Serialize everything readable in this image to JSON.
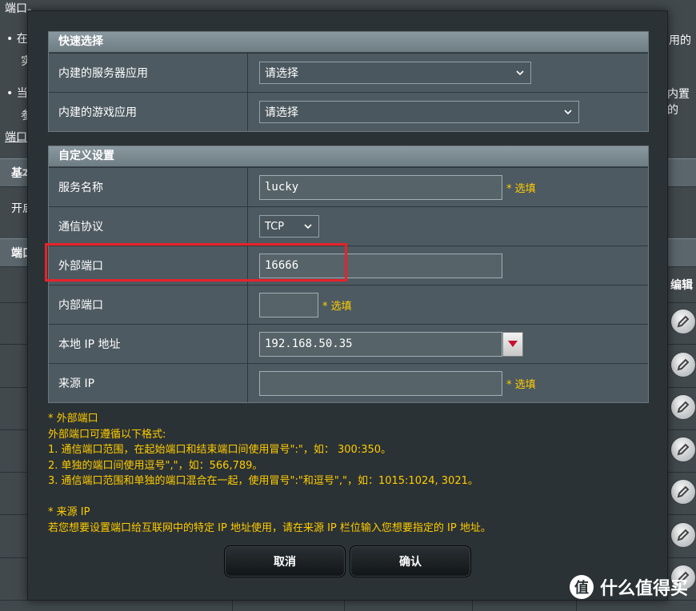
{
  "background": {
    "text_top": "端口。",
    "bullet_1_char": "在",
    "bullet_1_line2": "实",
    "bullet_1_right": "用的",
    "bullet_2_char": "当",
    "bullet_2_line2": "参",
    "bullet_2_right": "内置的",
    "section_link": "端口",
    "header_basic": "基本",
    "enable_label": "开启",
    "header_list": "端口",
    "column_edit": "编辑"
  },
  "quick_select": {
    "title": "快速选择",
    "rows": [
      {
        "label": "内建的服务器应用",
        "value": "请选择"
      },
      {
        "label": "内建的游戏应用",
        "value": "请选择"
      }
    ]
  },
  "custom": {
    "title": "自定义设置",
    "service_name": {
      "label": "服务名称",
      "value": "lucky",
      "hint": "* 选填"
    },
    "protocol": {
      "label": "通信协议",
      "value": "TCP"
    },
    "external_port": {
      "label": "外部端口",
      "value": "16666"
    },
    "internal_port": {
      "label": "内部端口",
      "value": "",
      "hint": "* 选填"
    },
    "local_ip": {
      "label": "本地 IP 地址",
      "value": "192.168.50.35"
    },
    "source_ip": {
      "label": "来源 IP",
      "value": "",
      "hint": "* 选填"
    }
  },
  "notes": {
    "ext_title": "* 外部端口",
    "ext_intro": "外部端口可遵循以下格式:",
    "ext_1": "1. 通信端口范围，在起始端口和结束端口间使用冒号\":\"，如： 300:350。",
    "ext_2": "2. 单独的端口间使用逗号\",\"，如：566,789。",
    "ext_3": "3. 通信端口范围和单独的端口混合在一起，使用冒号\":\"和逗号\",\"，如：1015:1024, 3021。",
    "src_title": "* 来源 IP",
    "src_text": "若您想要设置端口给互联网中的特定 IP 地址使用，请在来源 IP 栏位输入您想要指定的 IP 地址。"
  },
  "buttons": {
    "cancel": "取消",
    "confirm": "确认"
  },
  "watermark": {
    "logo": "值",
    "text": "什么值得买"
  },
  "colors": {
    "hint": "#ffcc00",
    "highlight": "#e8222a",
    "dropdown_arrow": "#c8102e"
  }
}
